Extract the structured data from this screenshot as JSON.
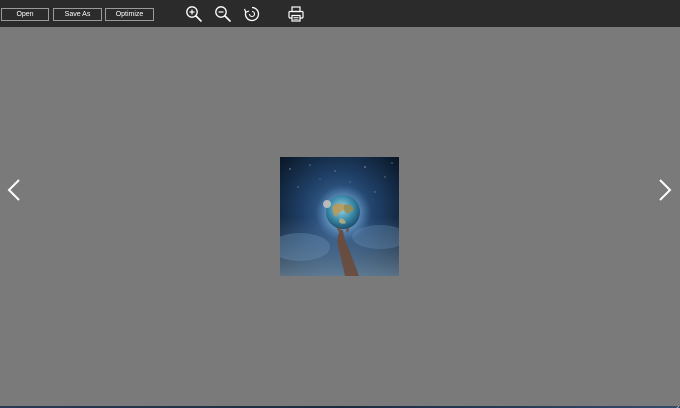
{
  "toolbar": {
    "open_label": "Open",
    "save_as_label": "Save As",
    "optimize_label": "Optimize",
    "icons": [
      "zoom-in-icon",
      "zoom-out-icon",
      "rotate-icon",
      "print-icon"
    ]
  },
  "viewer": {
    "image_subject": "hand holding glowing earth",
    "navigation": [
      "chevron-left-icon",
      "chevron-right-icon"
    ]
  },
  "colors": {
    "toolbar_bg": "#2b2b2b",
    "canvas_bg": "#7a7a7a",
    "button_border": "#9a9a9a",
    "text": "#ffffff"
  }
}
